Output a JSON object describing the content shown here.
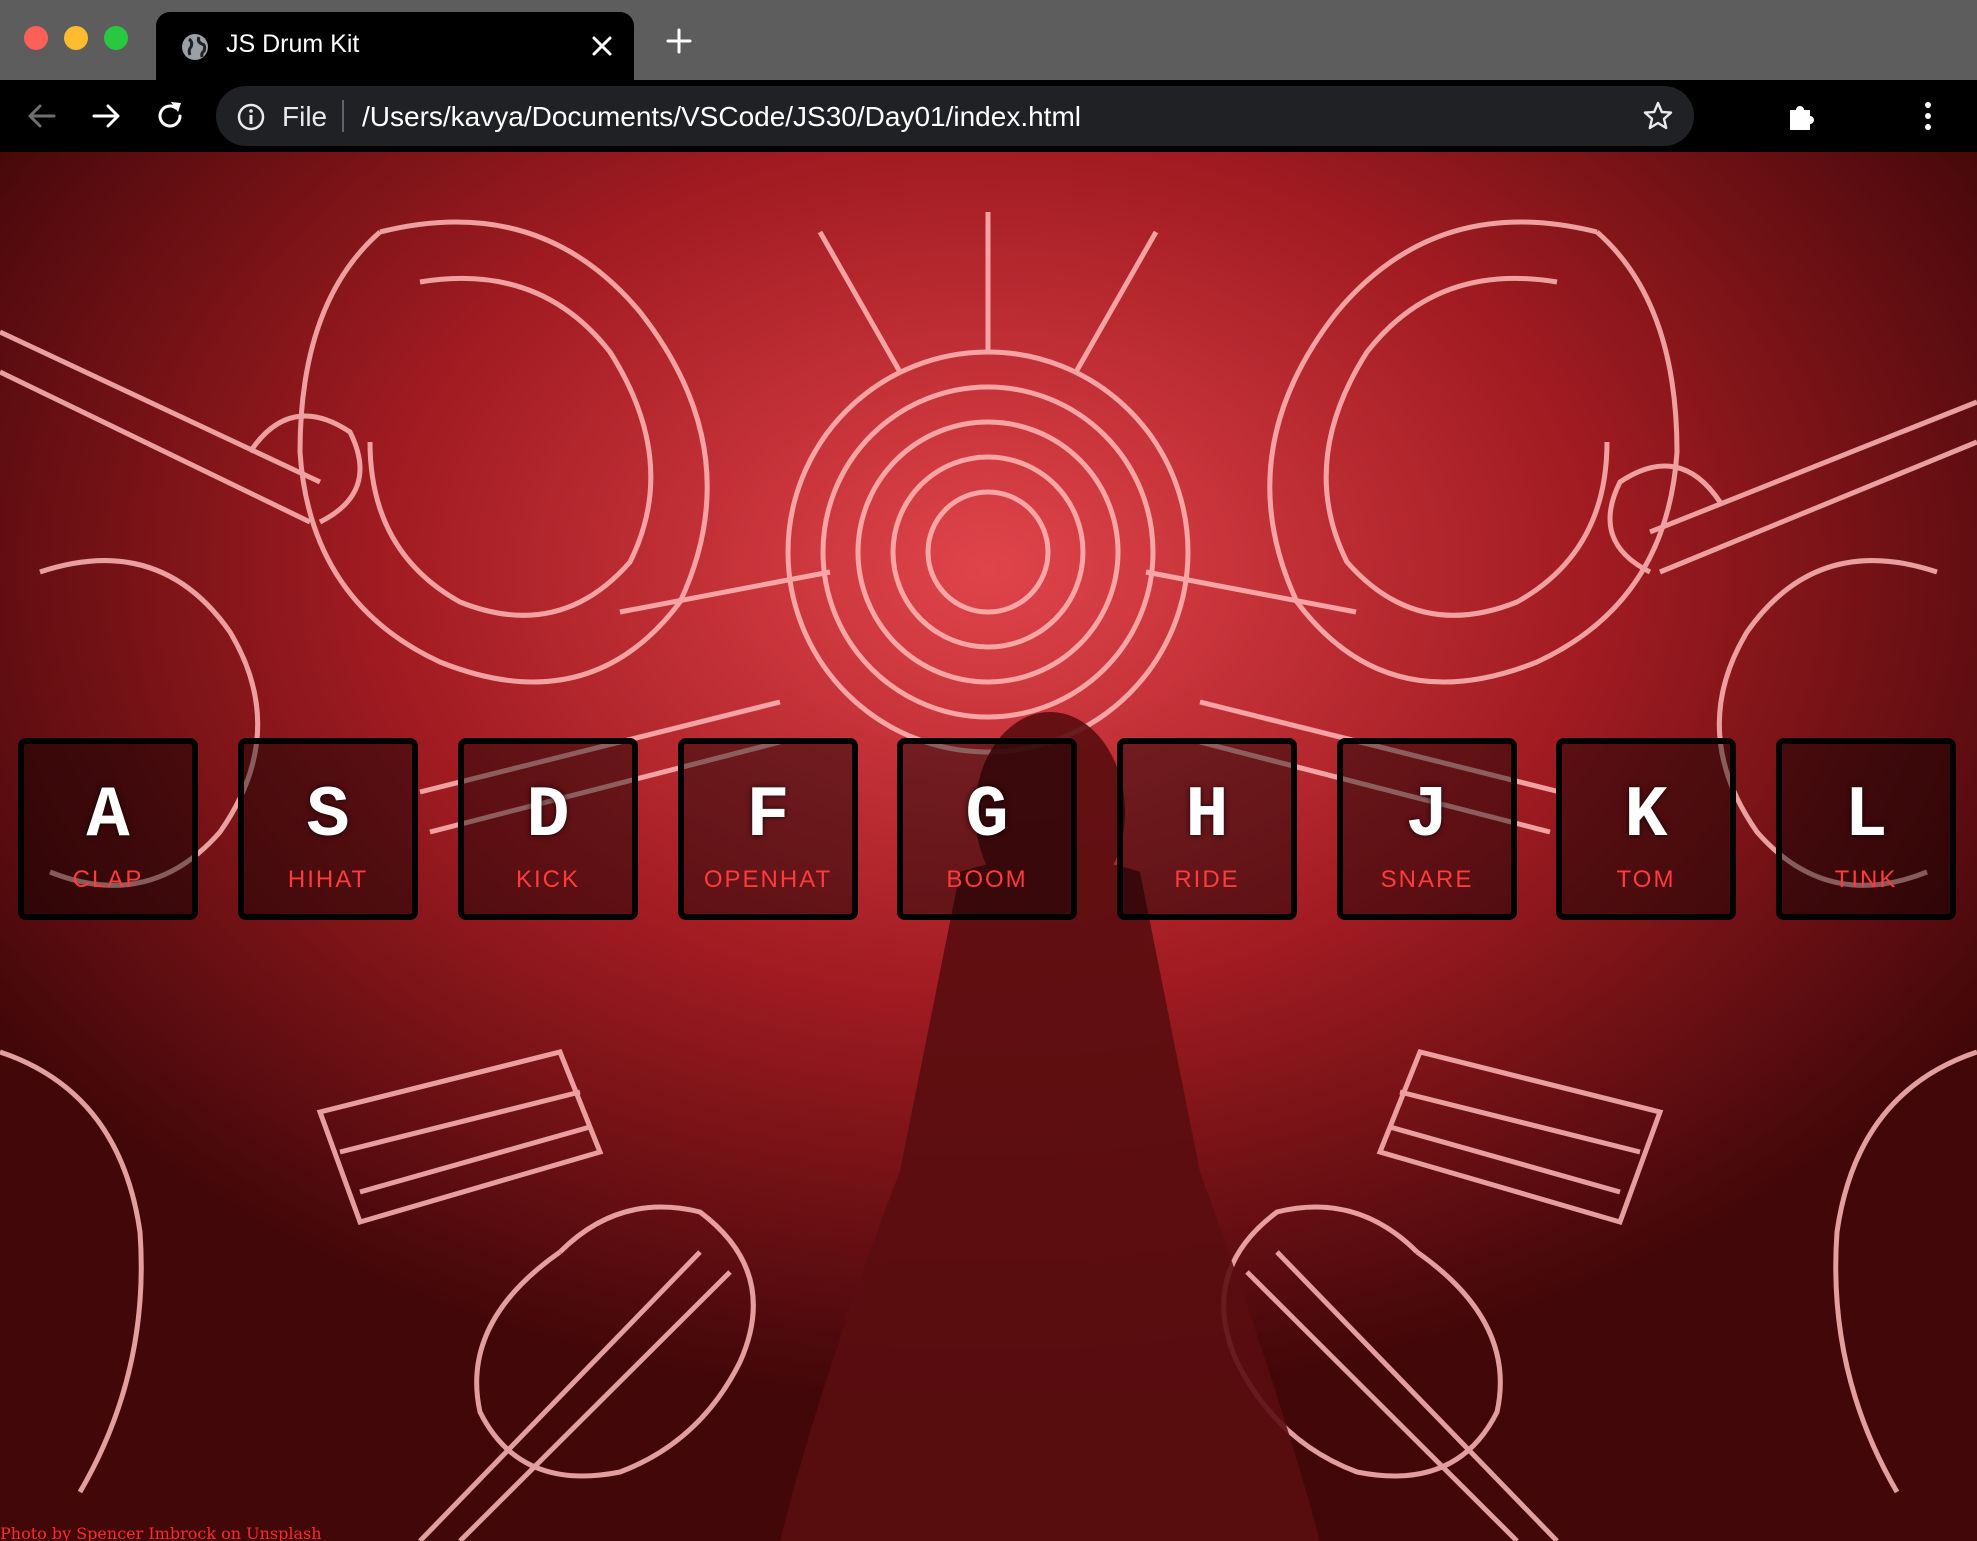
{
  "browser": {
    "tab_title": "JS Drum Kit",
    "url_scheme": "File",
    "url_path": "/Users/kavya/Documents/VSCode/JS30/Day01/index.html"
  },
  "keys": [
    {
      "letter": "A",
      "sound": "CLAP"
    },
    {
      "letter": "S",
      "sound": "HIHAT"
    },
    {
      "letter": "D",
      "sound": "KICK"
    },
    {
      "letter": "F",
      "sound": "OPENHAT"
    },
    {
      "letter": "G",
      "sound": "BOOM"
    },
    {
      "letter": "H",
      "sound": "RIDE"
    },
    {
      "letter": "J",
      "sound": "SNARE"
    },
    {
      "letter": "K",
      "sound": "TOM"
    },
    {
      "letter": "L",
      "sound": "TINK"
    }
  ],
  "credit": "Photo by Spencer Imbrock on Unsplash",
  "colors": {
    "sound_label": "#ff3b3b",
    "background": "#b4262d",
    "neon": "#ffb3b3"
  }
}
